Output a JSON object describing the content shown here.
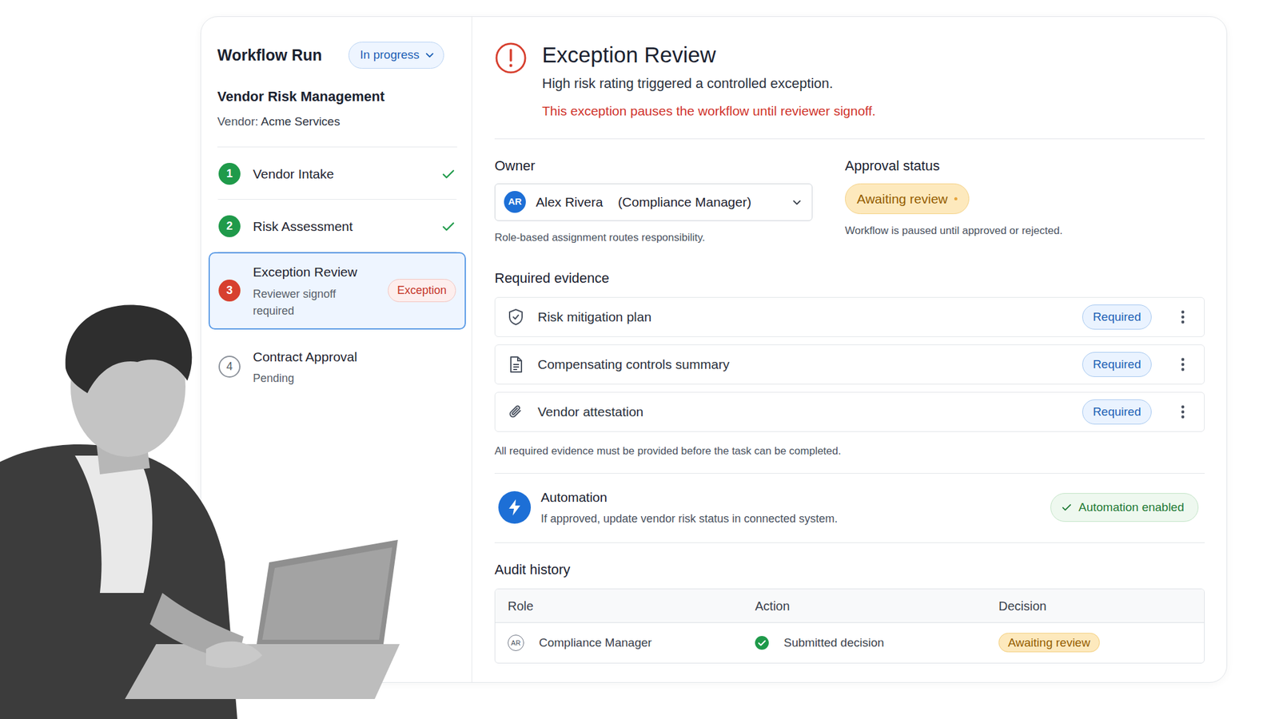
{
  "sidebar": {
    "title": "Workflow Run",
    "status": "In progress",
    "workflow": "Vendor Risk Management",
    "vendor_label": "Vendor:",
    "vendor": "Acme Services",
    "steps": [
      {
        "number": "1",
        "label": "Vendor Intake",
        "kind": "done",
        "selected": false
      },
      {
        "number": "2",
        "label": "Risk Assessment",
        "kind": "done",
        "selected": false
      },
      {
        "number": "3",
        "label": "Exception Review",
        "subtitle": "Reviewer signoff required",
        "badge": "Exception",
        "kind": "exception",
        "selected": true
      },
      {
        "number": "4",
        "label": "Contract Approval",
        "subtitle": "Pending",
        "kind": "pending",
        "selected": false
      }
    ]
  },
  "header": {
    "title": "Exception Review",
    "description": "High risk rating triggered a controlled exception.",
    "alert": "This exception pauses the workflow until reviewer signoff."
  },
  "owner": {
    "label": "Owner",
    "initials": "AR",
    "name": "Alex Rivera",
    "role": "(Compliance Manager)",
    "help": "Role-based assignment routes responsibility."
  },
  "approval": {
    "label": "Approval status",
    "badge": "Awaiting review",
    "note": "Workflow is paused until approved or rejected."
  },
  "evidence": {
    "title": "Required evidence",
    "items": [
      {
        "label": "Risk mitigation plan",
        "badge": "Required",
        "kind": "shield"
      },
      {
        "label": "Compensating controls summary",
        "badge": "Required",
        "kind": "document"
      },
      {
        "label": "Vendor attestation",
        "badge": "Required",
        "kind": "paperclip"
      }
    ],
    "note": "All required evidence must be provided before the task can be completed."
  },
  "automation": {
    "title": "Automation",
    "description": "If approved, update vendor risk status in connected system.",
    "badge": "Automation enabled",
    "enabled": true
  },
  "audit": {
    "title": "Audit history",
    "columns": [
      "Role",
      "Action",
      "Decision"
    ],
    "rows": [
      {
        "initials": "AR",
        "role": "Compliance Manager",
        "action": "Submitted decision",
        "decision": "Awaiting review"
      }
    ]
  }
}
